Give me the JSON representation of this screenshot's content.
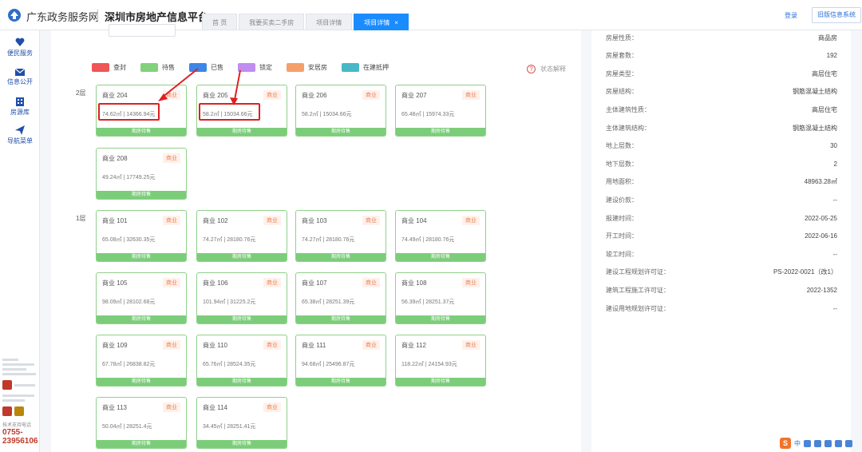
{
  "header": {
    "gov_name": "广东政务服务网",
    "platform_title": "深圳市房地产信息平台",
    "tabs": [
      "首 页",
      "我要买卖二手房",
      "项目详情",
      "项目详情"
    ],
    "active_tab_close": "×",
    "login": "登录",
    "old_system": "旧版信息系统"
  },
  "sidebar": {
    "items": [
      "便民服务",
      "信息公开",
      "房源库",
      "导航菜单"
    ],
    "tech_support": "技术支持电话",
    "hotline": "0755-23956106"
  },
  "legend": [
    {
      "label": "查封",
      "color": "#f05656"
    },
    {
      "label": "待售",
      "color": "#82d17c"
    },
    {
      "label": "已售",
      "color": "#3d86e6"
    },
    {
      "label": "锁定",
      "color": "#c08df0"
    },
    {
      "label": "安居房",
      "color": "#f5a06a"
    },
    {
      "label": "在建抵押",
      "color": "#49b8c6"
    }
  ],
  "status_help": "状态解释",
  "floors": [
    {
      "label": "2层",
      "units": [
        {
          "name": "商业 204",
          "tag": "商业",
          "info": "74.62㎡ | 14366.94元",
          "status": "期房待售"
        },
        {
          "name": "商业 205",
          "tag": "商业",
          "info": "58.2㎡ | 15034.66元",
          "status": "期房待售"
        },
        {
          "name": "商业 206",
          "tag": "商业",
          "info": "58.2㎡ | 15034.66元",
          "status": "期房待售"
        },
        {
          "name": "商业 207",
          "tag": "商业",
          "info": "65.48㎡ | 15974.33元",
          "status": "期房待售"
        },
        {
          "name": "商业 208",
          "tag": "商业",
          "info": "49.24㎡ | 17749.25元",
          "status": "期房待售"
        }
      ]
    },
    {
      "label": "1层",
      "units": [
        {
          "name": "商业 101",
          "tag": "商业",
          "info": "65.08㎡ | 32630.35元",
          "status": "期房待售"
        },
        {
          "name": "商业 102",
          "tag": "商业",
          "info": "74.27㎡ | 28180.76元",
          "status": "期房待售"
        },
        {
          "name": "商业 103",
          "tag": "商业",
          "info": "74.27㎡ | 28180.76元",
          "status": "期房待售"
        },
        {
          "name": "商业 104",
          "tag": "商业",
          "info": "74.49㎡ | 28180.76元",
          "status": "期房待售"
        },
        {
          "name": "商业 105",
          "tag": "商业",
          "info": "98.09㎡ | 28102.68元",
          "status": "期房待售"
        },
        {
          "name": "商业 106",
          "tag": "商业",
          "info": "101.94㎡ | 31225.2元",
          "status": "期房待售"
        },
        {
          "name": "商业 107",
          "tag": "商业",
          "info": "65.38㎡ | 28251.39元",
          "status": "期房待售"
        },
        {
          "name": "商业 108",
          "tag": "商业",
          "info": "56.39㎡ | 28251.37元",
          "status": "期房待售"
        },
        {
          "name": "商业 109",
          "tag": "商业",
          "info": "67.78㎡ | 26838.82元",
          "status": "期房待售"
        },
        {
          "name": "商业 110",
          "tag": "商业",
          "info": "65.76㎡ | 28524.35元",
          "status": "期房待售"
        },
        {
          "name": "商业 111",
          "tag": "商业",
          "info": "94.68㎡ | 25496.87元",
          "status": "期房待售"
        },
        {
          "name": "商业 112",
          "tag": "商业",
          "info": "118.22㎡ | 24154.93元",
          "status": "期房待售"
        },
        {
          "name": "商业 113",
          "tag": "商业",
          "info": "50.04㎡ | 28251.4元",
          "status": "期房待售"
        },
        {
          "name": "商业 114",
          "tag": "商业",
          "info": "34.45㎡ | 28251.41元",
          "status": "期房待售"
        }
      ]
    }
  ],
  "attributes": [
    {
      "label": "房屋性质：",
      "value": "商品房"
    },
    {
      "label": "房屋套数：",
      "value": "192"
    },
    {
      "label": "房屋类型：",
      "value": "高层住宅"
    },
    {
      "label": "房屋结构：",
      "value": "钢筋混凝土结构"
    },
    {
      "label": "主体建筑性质：",
      "value": "高层住宅"
    },
    {
      "label": "主体建筑结构：",
      "value": "钢筋混凝土结构"
    },
    {
      "label": "地上层数：",
      "value": "30"
    },
    {
      "label": "地下层数：",
      "value": "2"
    },
    {
      "label": "用地面积：",
      "value": "48963.28㎡"
    },
    {
      "label": "建设价款：",
      "value": "--"
    },
    {
      "label": "报建时间：",
      "value": "2022-05-25"
    },
    {
      "label": "开工时间：",
      "value": "2022-06-16"
    },
    {
      "label": "竣工时间：",
      "value": "--"
    },
    {
      "label": "建设工程规划许可证：",
      "value": "PS-2022-0021（改1）"
    },
    {
      "label": "建筑工程施工许可证：",
      "value": "2022-1352"
    },
    {
      "label": "建设用地规划许可证：",
      "value": "--"
    }
  ],
  "tray": {
    "ime_logo": "S",
    "ime_mode": "中"
  }
}
